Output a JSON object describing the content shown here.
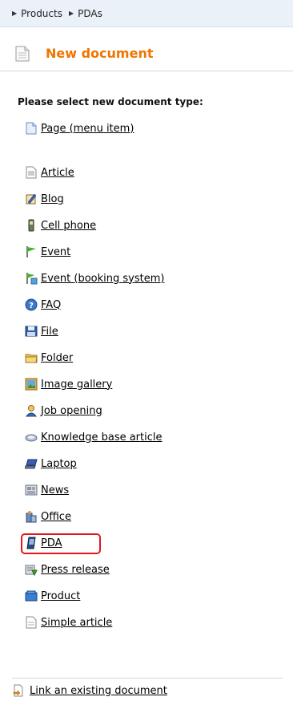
{
  "breadcrumb": {
    "items": [
      "Products",
      "PDAs"
    ]
  },
  "header": {
    "title": "New document"
  },
  "prompt": "Please select new document type:",
  "doc_types": [
    {
      "label": "Page (menu item)",
      "icon": "page-icon"
    },
    {
      "label": "Article",
      "icon": "article-icon"
    },
    {
      "label": "Blog",
      "icon": "blog-icon"
    },
    {
      "label": "Cell phone",
      "icon": "cell-phone-icon"
    },
    {
      "label": "Event",
      "icon": "event-flag-icon"
    },
    {
      "label": "Event (booking system)",
      "icon": "event-booking-icon"
    },
    {
      "label": "FAQ",
      "icon": "faq-icon"
    },
    {
      "label": "File",
      "icon": "file-icon"
    },
    {
      "label": "Folder",
      "icon": "folder-icon"
    },
    {
      "label": "Image gallery",
      "icon": "image-gallery-icon"
    },
    {
      "label": "Job opening",
      "icon": "job-opening-icon"
    },
    {
      "label": "Knowledge base article",
      "icon": "knowledge-base-icon"
    },
    {
      "label": "Laptop",
      "icon": "laptop-icon"
    },
    {
      "label": "News",
      "icon": "news-icon"
    },
    {
      "label": "Office",
      "icon": "office-icon"
    },
    {
      "label": "PDA",
      "icon": "pda-icon"
    },
    {
      "label": "Press release",
      "icon": "press-release-icon"
    },
    {
      "label": "Product",
      "icon": "product-icon"
    },
    {
      "label": "Simple article",
      "icon": "simple-article-icon"
    }
  ],
  "footer": {
    "link_label": "Link an existing document"
  },
  "colors": {
    "title": "#ee7500",
    "highlight": "#e2161d",
    "breadcrumb_bg": "#eaf1f9"
  }
}
